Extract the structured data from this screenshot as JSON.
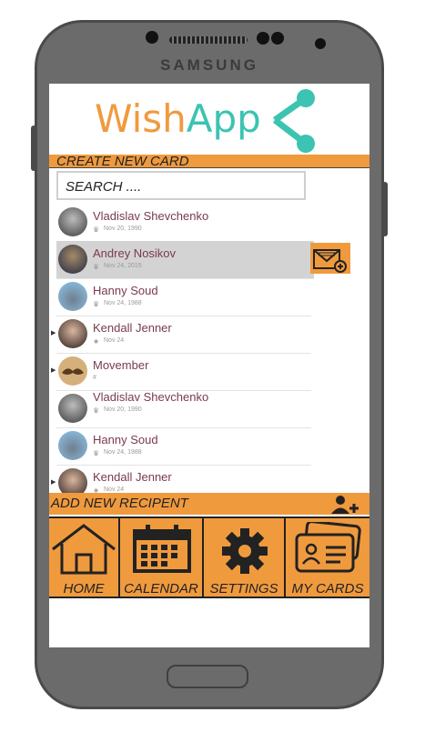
{
  "device": {
    "brand": "SAMSUNG"
  },
  "app": {
    "logo_part1": "Wish",
    "logo_part2": "App"
  },
  "create_bar": {
    "label": "CREATE NEW CARD"
  },
  "search": {
    "text": "SEARCH ...."
  },
  "contacts": [
    {
      "name": "Vladislav Shevchenko",
      "date": "Nov 20, 1990"
    },
    {
      "name": "Andrey Nosikov",
      "date": "Nov 24, 2015"
    },
    {
      "name": "Hanny Soud",
      "date": "Nov 24, 1988"
    },
    {
      "name": "Kendall Jenner",
      "date": "Nov 24"
    },
    {
      "name": "Movember",
      "date": "#"
    },
    {
      "name": "Vladislav Shevchenko",
      "date": "Nov 20, 1990"
    },
    {
      "name": "Hanny Soud",
      "date": "Nov 24, 1988"
    },
    {
      "name": "Kendall Jenner",
      "date": "Nov 24"
    }
  ],
  "add_bar": {
    "label": "ADD NEW RECIPENT"
  },
  "tabs": {
    "home": "HOME",
    "calendar": "CALENDAR",
    "settings": "SETTINGS",
    "my_cards": "MY CARDS"
  },
  "colors": {
    "accent": "#f09a3e",
    "teal": "#3cc3b2",
    "name_text": "#7a3a4c"
  }
}
